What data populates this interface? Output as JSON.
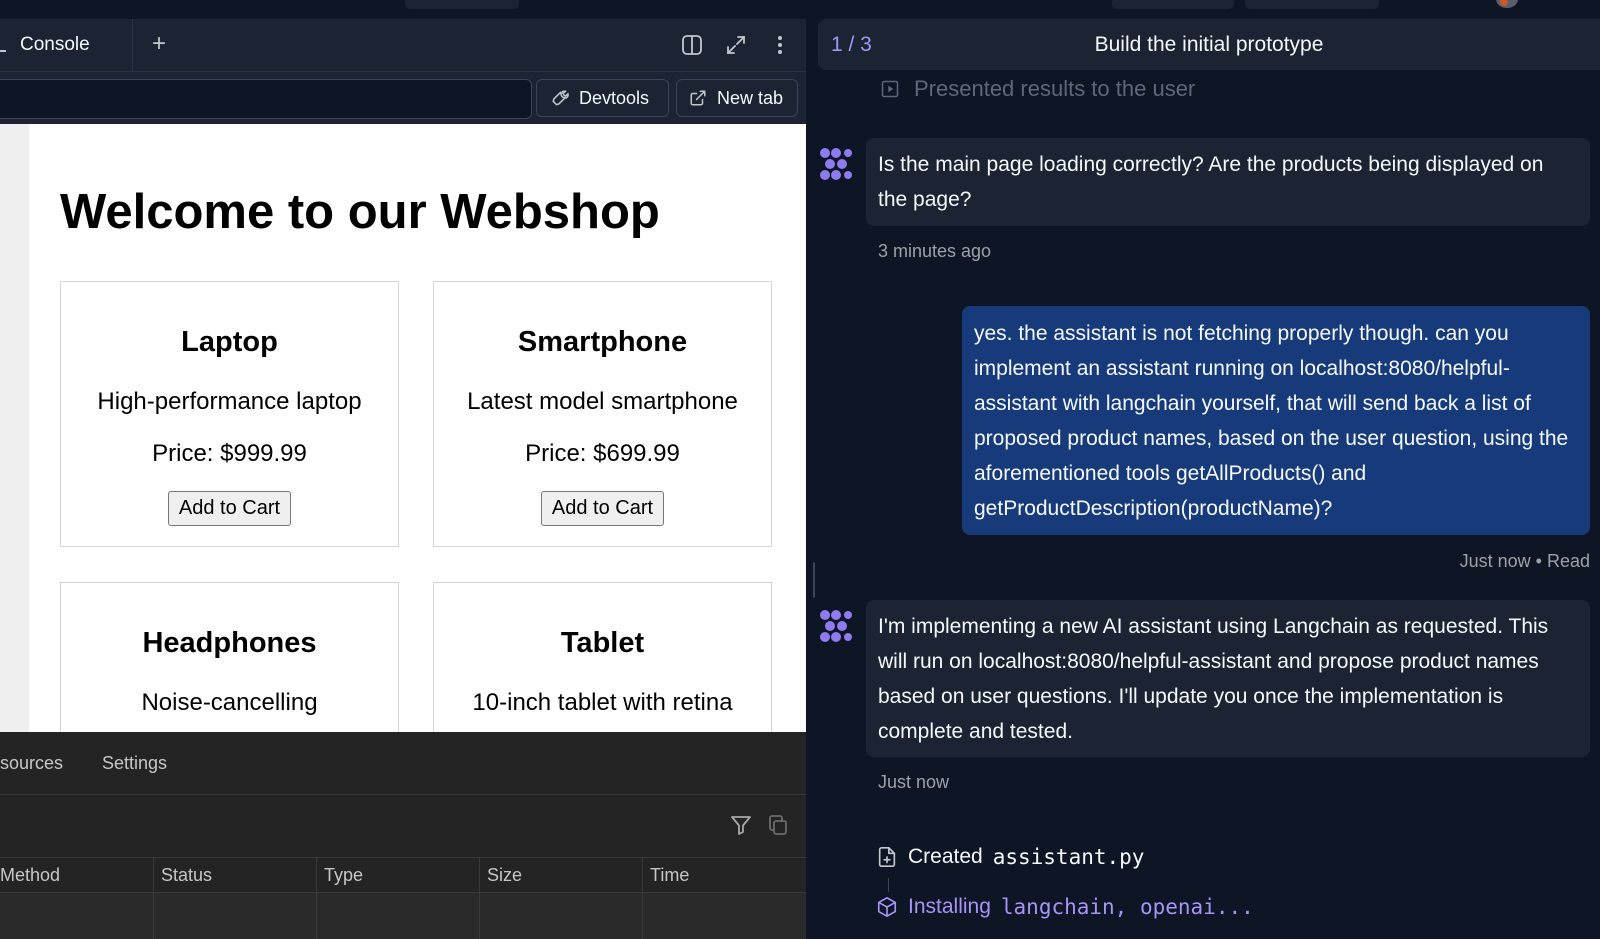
{
  "workspace": {
    "tabs": [
      {
        "label": "Console"
      }
    ],
    "new_tab_symbol": "+",
    "toolbar_icons": [
      "split-view-icon",
      "expand-icon",
      "more-vertical-icon"
    ]
  },
  "webview": {
    "url": "",
    "devtools_label": "Devtools",
    "new_tab_label": "New tab"
  },
  "shop": {
    "title": "Welcome to our Webshop",
    "products": [
      {
        "name": "Laptop",
        "description": "High-performance laptop",
        "price": "Price: $999.99",
        "button": "Add to Cart"
      },
      {
        "name": "Smartphone",
        "description": "Latest model smartphone",
        "price": "Price: $699.99",
        "button": "Add to Cart"
      },
      {
        "name": "Headphones",
        "description": "Noise-cancelling"
      },
      {
        "name": "Tablet",
        "description": "10-inch tablet with retina"
      }
    ]
  },
  "devtools": {
    "tabs": [
      "sources",
      "Settings"
    ],
    "columns": [
      "Method",
      "Status",
      "Type",
      "Size",
      "Time"
    ]
  },
  "chat": {
    "step": {
      "counter": "1 / 3",
      "title": "Build the initial prototype"
    },
    "prev_status": "Presented results to the user",
    "messages": [
      {
        "role": "agent",
        "text": "Is the main page loading correctly? Are the products being displayed on the page?",
        "time": "3 minutes ago"
      },
      {
        "role": "user",
        "text": "yes. the assistant is not fetching properly though. can you implement an assistant running on localhost:8080/helpful-assistant with langchain yourself, that will send back a list of proposed product names, based on the user question, using the aforementioned tools getAllProducts() and getProductDescription(productName)?",
        "time": "Just now",
        "read": "Read"
      },
      {
        "role": "agent",
        "text": "I'm implementing a new AI assistant using Langchain as requested. This will run on localhost:8080/helpful-assistant and propose product names based on user questions. I'll update you once the implementation is complete and tested.",
        "time": "Just now"
      }
    ],
    "activities": [
      {
        "verb": "Created",
        "target": "assistant.py"
      },
      {
        "verb": "Installing",
        "target": "langchain, openai..."
      }
    ]
  },
  "colors": {
    "accent": "#a794f8",
    "user_bubble": "#173a7a",
    "agent_bubble": "#1c2333",
    "background": "#0e1525"
  }
}
